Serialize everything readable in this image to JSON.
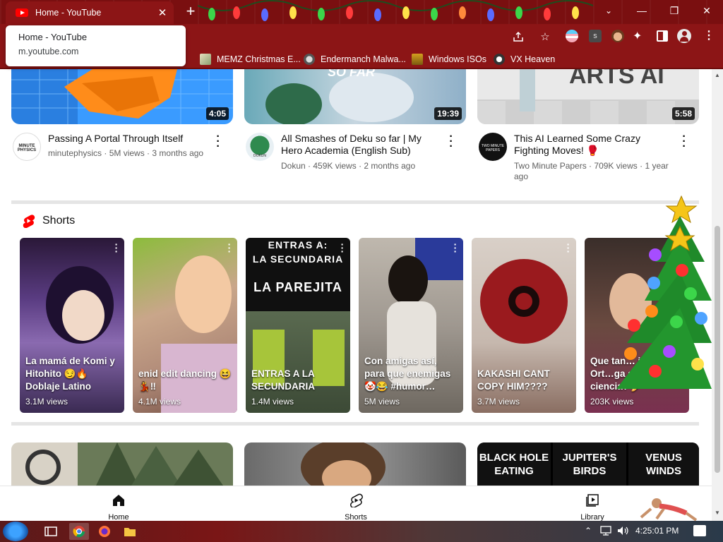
{
  "browser": {
    "tab_title": "Home - YouTube",
    "tab_close": "✕",
    "new_tab": "+",
    "url_popup": {
      "title": "Home - YouTube",
      "url": "m.youtube.com"
    },
    "bookmarks": [
      {
        "label": "MEMZ Christmas E...",
        "icon": "memz-icon"
      },
      {
        "label": "Endermanch Malwa...",
        "icon": "endermanch-icon"
      },
      {
        "label": "Windows ISOs",
        "icon": "windows-iso-icon"
      },
      {
        "label": "VX Heaven",
        "icon": "vx-heaven-icon"
      }
    ],
    "window_controls": {
      "tab_search": "⌄",
      "minimize": "—",
      "maximize": "❐",
      "close": "✕"
    }
  },
  "videos_top": [
    {
      "title": "Passing A Portal Through Itself",
      "channel": "minutephysics",
      "views": "5M views",
      "age": "3 months ago",
      "duration": "4:05",
      "avatar_text": "MINUTE PHYSICS"
    },
    {
      "title": "All Smashes of Deku so far | My Hero Academia (English Sub)",
      "channel": "Dokun",
      "views": "459K views",
      "age": "2 months ago",
      "duration": "19:39",
      "thumb_text": "SO FAR",
      "avatar_text": "DOKUN"
    },
    {
      "title": "This AI Learned Some Crazy Fighting Moves! 🥊",
      "channel": "Two Minute Papers",
      "views": "709K views",
      "age": "1 year ago",
      "duration": "5:58",
      "thumb_text": "ARTS AI",
      "avatar_text": "TWO MINUTE PAPERS"
    }
  ],
  "shorts": {
    "section_title": "Shorts",
    "items": [
      {
        "caption": "La mamá de Komi y Hitohito 😏🔥 Doblaje Latino",
        "views": "3.1M views"
      },
      {
        "caption": "enid edit dancing 😆💃‼",
        "views": "4.1M views"
      },
      {
        "caption": "ENTRAS A LA SECUNDARIA",
        "views": "1.4M views",
        "overlay_line1": "ENTRAS A:",
        "overlay_line2": "LA SECUNDARIA",
        "overlay_line3": "LA PAREJITA"
      },
      {
        "caption": "Con amigas así, para que enemigas 🤡😂 #humor…",
        "views": "5M views"
      },
      {
        "caption": "KAKASHI CANT COPY HIM????",
        "views": "3.7M views"
      },
      {
        "caption": "Que tan… jenna Ort…ga segú… la ciencia? 🥖",
        "views": "203K views"
      }
    ]
  },
  "videos_bottom": [
    {
      "panels": []
    },
    {
      "panels": []
    },
    {
      "panels": [
        "BLACK HOLE EATING",
        "JUPITER'S BIRDS",
        "VENUS WINDS"
      ]
    }
  ],
  "bottom_nav": [
    {
      "label": "Home",
      "icon": "home-icon"
    },
    {
      "label": "Shorts",
      "icon": "shorts-icon"
    },
    {
      "label": "Library",
      "icon": "library-icon"
    }
  ],
  "taskbar": {
    "clock": "4:25:01 PM",
    "apps": [
      "task-view-icon",
      "chrome-icon",
      "firefox-icon",
      "file-explorer-icon"
    ]
  },
  "colors": {
    "browser_theme": "#8c1516",
    "youtube_red": "#ff0000",
    "text_primary": "#0f0f0f",
    "text_secondary": "#606060"
  }
}
